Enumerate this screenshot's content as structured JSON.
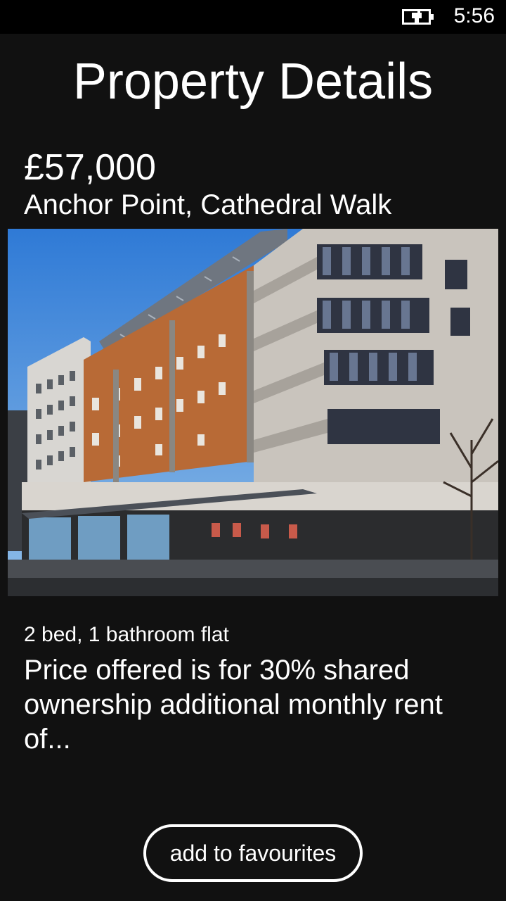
{
  "status_bar": {
    "time": "5:56",
    "battery_icon": "battery-charging-icon"
  },
  "page": {
    "title": "Property Details"
  },
  "property": {
    "price": "£57,000",
    "address": "Anchor Point, Cathedral Walk",
    "photo": "building-photo",
    "summary": "2 bed, 1 bathroom flat",
    "description": "Price offered is for 30% shared ownership additional monthly rent of..."
  },
  "actions": {
    "favourite_label": "add to favourites"
  },
  "colors": {
    "background": "#111111",
    "status_bar": "#000000",
    "text": "#ffffff",
    "sky": "#3f86d8",
    "facade_orange": "#b86a36",
    "facade_grey": "#c9c4bd"
  }
}
